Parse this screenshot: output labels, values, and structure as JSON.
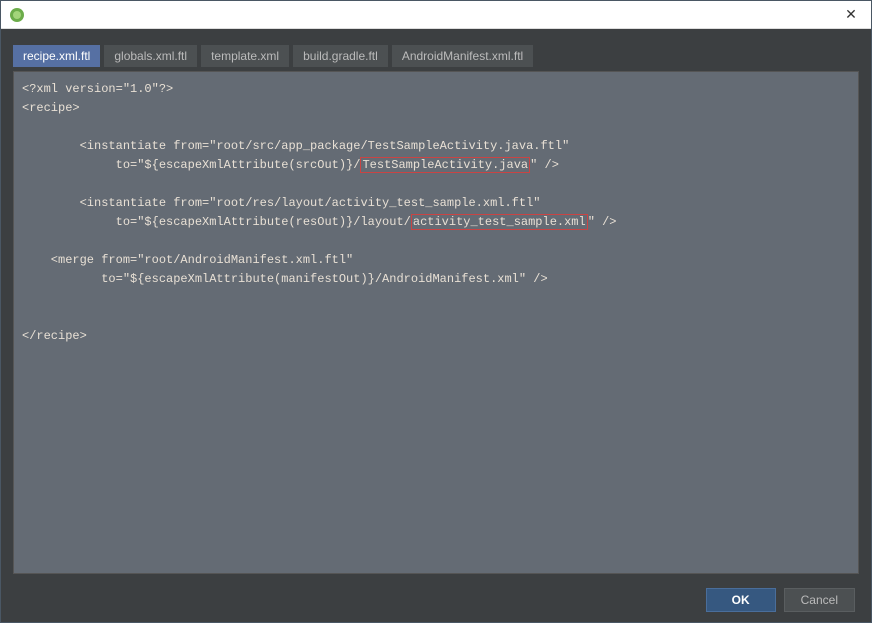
{
  "titlebar": {
    "close_label": "✕"
  },
  "tabs": [
    {
      "label": "recipe.xml.ftl",
      "active": true
    },
    {
      "label": "globals.xml.ftl",
      "active": false
    },
    {
      "label": "template.xml",
      "active": false
    },
    {
      "label": "build.gradle.ftl",
      "active": false
    },
    {
      "label": "AndroidManifest.xml.ftl",
      "active": false
    }
  ],
  "editor": {
    "line1": "<?xml version=\"1.0\"?>",
    "line2": "<recipe>",
    "line3": "",
    "line4": "        <instantiate from=\"root/src/app_package/TestSampleActivity.java.ftl\"",
    "line5a": "             to=\"${escapeXmlAttribute(srcOut)}/",
    "line5_hl": "TestSampleActivity.java",
    "line5b": "\" />",
    "line6": "",
    "line7": "        <instantiate from=\"root/res/layout/activity_test_sample.xml.ftl\"",
    "line8a": "             to=\"${escapeXmlAttribute(resOut)}/layout/",
    "line8_hl": "activity_test_sample.xml",
    "line8b": "\" />",
    "line9": "",
    "line10": "    <merge from=\"root/AndroidManifest.xml.ftl\"",
    "line11": "           to=\"${escapeXmlAttribute(manifestOut)}/AndroidManifest.xml\" />",
    "line12": "",
    "line13": "",
    "line14": "</recipe>"
  },
  "buttons": {
    "ok": "OK",
    "cancel": "Cancel"
  }
}
